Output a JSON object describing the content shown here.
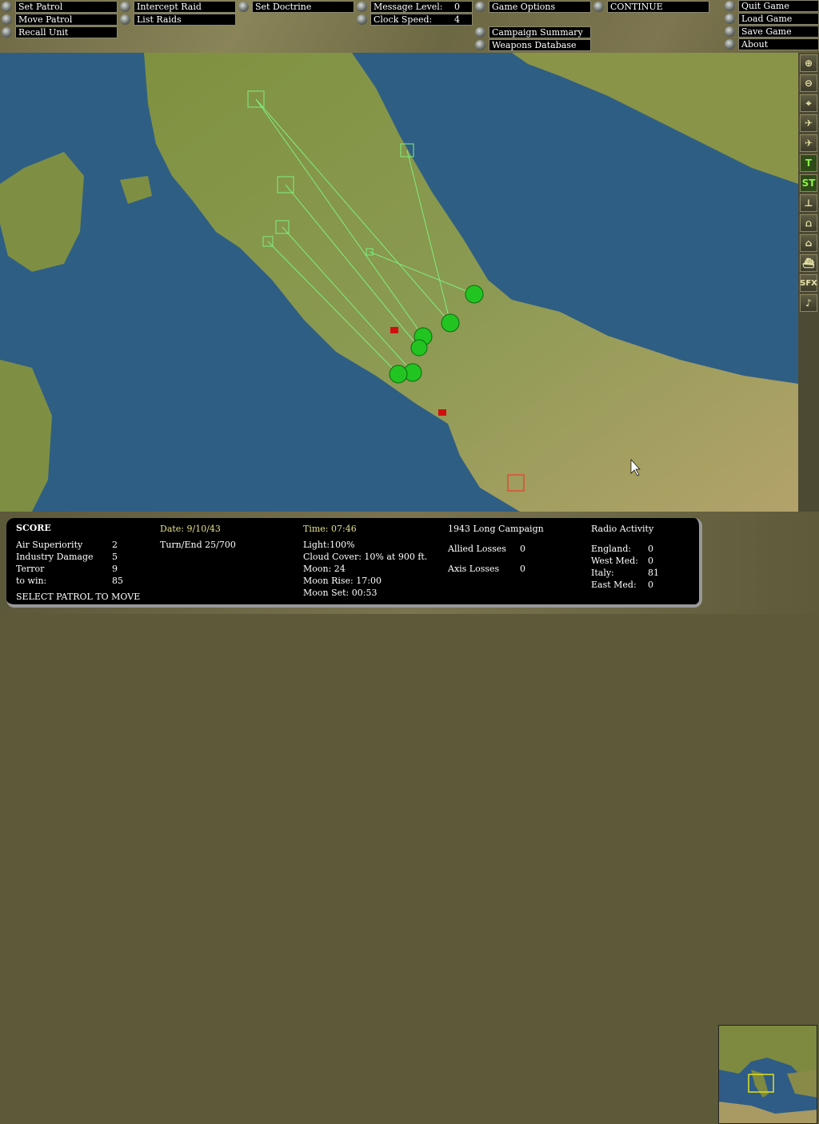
{
  "toolbar": {
    "set_patrol": "Set Patrol",
    "move_patrol": "Move Patrol",
    "recall_unit": "Recall Unit",
    "intercept_raid": "Intercept Raid",
    "list_raids": "List Raids",
    "set_doctrine": "Set Doctrine",
    "message_level_label": "Message Level:",
    "message_level_value": "0",
    "clock_speed_label": "Clock Speed:",
    "clock_speed_value": "4",
    "game_options": "Game Options",
    "continue": "CONTINUE",
    "campaign_summary": "Campaign Summary",
    "weapons_database": "Weapons Database",
    "quit_game": "Quit Game",
    "load_game": "Load Game",
    "save_game": "Save Game",
    "about": "About"
  },
  "side_tools": [
    "zoom-in",
    "zoom-out",
    "center",
    "allied-air",
    "axis-air",
    "flak",
    "ST",
    "radar",
    "searchlight",
    "factory",
    "ships",
    "SFX",
    "music"
  ],
  "side_tool_labels": {
    "st": "ST",
    "sfx": "SFX",
    "music": "♪"
  },
  "score": {
    "title": "SCORE",
    "rows": [
      {
        "label": "Air Superiority",
        "value": "2"
      },
      {
        "label": "Industry Damage",
        "value": "5"
      },
      {
        "label": "Terror",
        "value": "9"
      },
      {
        "label": "to win:",
        "value": "85"
      }
    ],
    "status": "SELECT PATROL TO MOVE"
  },
  "date": {
    "date": "Date: 9/10/43",
    "turn": "Turn/End  25/700"
  },
  "conditions": {
    "time": "Time: 07:46",
    "light": "Light:100%",
    "cloud": "Cloud Cover: 10% at 900 ft.",
    "moon": "Moon: 24",
    "moon_rise": "Moon Rise: 17:00",
    "moon_set": "Moon Set: 00:53"
  },
  "campaign": {
    "name": "1943 Long Campaign",
    "allied_label": "Allied Losses",
    "allied_value": "0",
    "axis_label": "Axis Losses",
    "axis_value": "0"
  },
  "radio": {
    "title": "Radio Activity",
    "rows": [
      {
        "label": "England:",
        "value": "0"
      },
      {
        "label": "West Med:",
        "value": "0"
      },
      {
        "label": "Italy:",
        "value": "81"
      },
      {
        "label": "East Med:",
        "value": "0"
      }
    ]
  },
  "colors": {
    "accent": "#e4e08a",
    "patrol": "#3ad43a",
    "sea": "#2f5e84",
    "land": "#8e9a4c"
  }
}
